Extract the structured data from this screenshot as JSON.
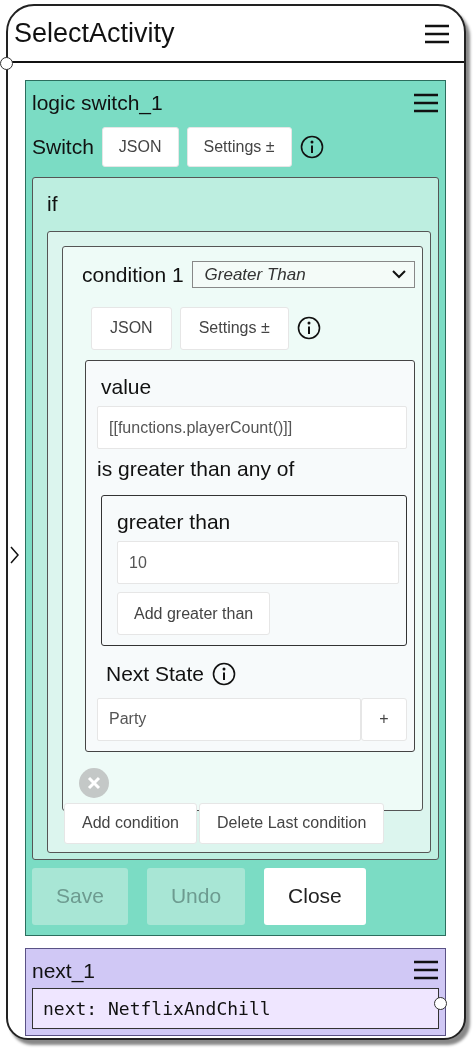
{
  "window": {
    "title": "SelectActivity"
  },
  "switch_node": {
    "title": "logic switch_1",
    "label": "Switch",
    "buttons": [
      "JSON",
      "Settings ±"
    ],
    "if_label": "if",
    "conditions": [
      {
        "label": "condition 1",
        "operator": "Greater Than",
        "buttons": [
          "JSON",
          "Settings ±"
        ],
        "value_label": "value",
        "value": "[[functions.playerCount()]]",
        "comparison_text": "is greater than any of",
        "list_label": "greater than",
        "items": [
          "10"
        ],
        "add_button": "Add greater than",
        "next_state_label": "Next State",
        "next_state": "Party",
        "plus_button": "+"
      }
    ],
    "condition_buttons": [
      "Add condition",
      "Delete Last condition"
    ],
    "actions": [
      {
        "label": "Save",
        "disabled": true
      },
      {
        "label": "Undo",
        "disabled": true
      },
      {
        "label": "Close",
        "disabled": false
      }
    ]
  },
  "next_node": {
    "title": "next_1",
    "text": "next: NetflixAndChill"
  }
}
